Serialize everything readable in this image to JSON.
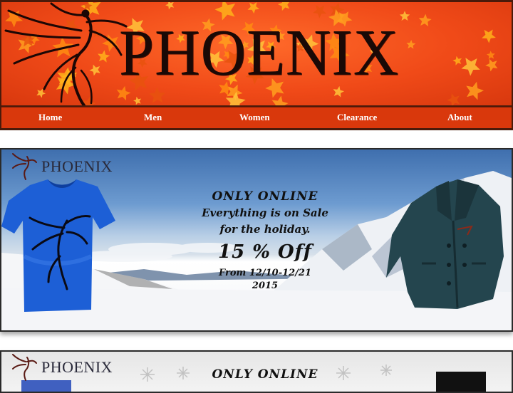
{
  "site": {
    "title": "PHOENIX",
    "logo_icon": "phoenix-bird-icon",
    "colors": {
      "banner": "#f04a18",
      "nav": "#d9380c",
      "nav_text": "#ffffff",
      "title_text": "#1a0906"
    }
  },
  "nav": {
    "items": [
      {
        "label": "Home"
      },
      {
        "label": "Men"
      },
      {
        "label": "Women"
      },
      {
        "label": "Clearance"
      },
      {
        "label": "About"
      }
    ]
  },
  "promos": [
    {
      "brand": "PHOENIX",
      "line1": "ONLY ONLINE",
      "line2": "Everything is on Sale",
      "line3": "for the holiday.",
      "discount": "15 % Off",
      "dates": "From 12/10-12/21",
      "year": "2015",
      "products": [
        "blue-phoenix-tshirt",
        "dark-teal-wool-coat"
      ]
    },
    {
      "brand": "PHOENIX",
      "line1": "ONLY ONLINE"
    }
  ]
}
